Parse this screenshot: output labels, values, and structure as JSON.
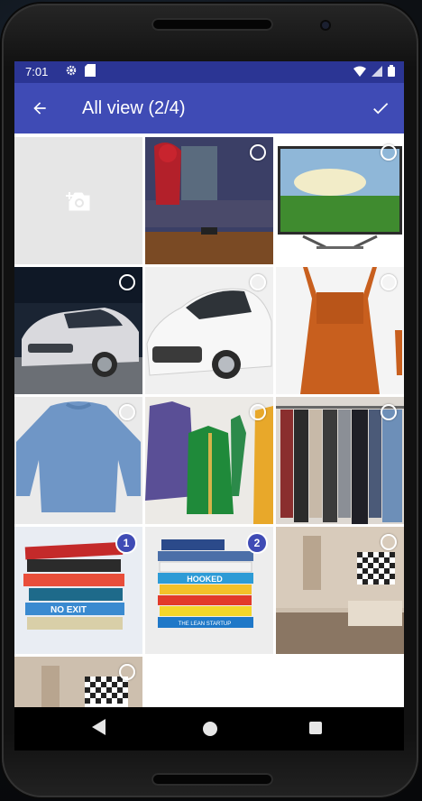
{
  "status_bar": {
    "time": "7:01",
    "icons_left": [
      "gear-icon",
      "sd-card-icon"
    ],
    "icons_right": [
      "wifi-icon",
      "signal-icon",
      "battery-icon"
    ]
  },
  "app_bar": {
    "title": "All view (2/4)",
    "back_icon": "arrow-back-icon",
    "confirm_icon": "check-icon"
  },
  "colors": {
    "status_bar": "#2b3594",
    "app_bar": "#3f4bb5",
    "selection_badge": "#3f4bb5"
  },
  "grid": {
    "items": [
      {
        "kind": "camera",
        "icon": "add-camera-icon"
      },
      {
        "kind": "image",
        "subject": "Spider-Man on TV",
        "selected": false
      },
      {
        "kind": "image",
        "subject": "TV with landscape",
        "selected": false
      },
      {
        "kind": "image",
        "subject": "white Ford sedan",
        "selected": false
      },
      {
        "kind": "image",
        "subject": "white Toyota Corolla",
        "selected": false
      },
      {
        "kind": "image",
        "subject": "orange pinafore dress",
        "selected": false
      },
      {
        "kind": "image",
        "subject": "blue sweatshirt",
        "selected": false
      },
      {
        "kind": "image",
        "subject": "purple shirt and green jacket",
        "selected": false
      },
      {
        "kind": "image",
        "subject": "clothes on rack",
        "selected": false
      },
      {
        "kind": "image",
        "subject": "stack of books (No Exit)",
        "selected": true,
        "order": "1"
      },
      {
        "kind": "image",
        "subject": "stack of books (Hooked)",
        "selected": true,
        "order": "2"
      },
      {
        "kind": "image",
        "subject": "room with checkered TV",
        "selected": false
      },
      {
        "kind": "image",
        "subject": "room with checkered TV",
        "selected": false
      }
    ]
  },
  "book_titles": {
    "stack1": [
      "NO EXIT"
    ],
    "stack2": [
      "HOOKED",
      "THE LEAN STARTUP"
    ]
  },
  "nav_bar": {
    "back_icon": "triangle-back-icon",
    "home_icon": "circle-home-icon",
    "recents_icon": "square-recents-icon"
  }
}
